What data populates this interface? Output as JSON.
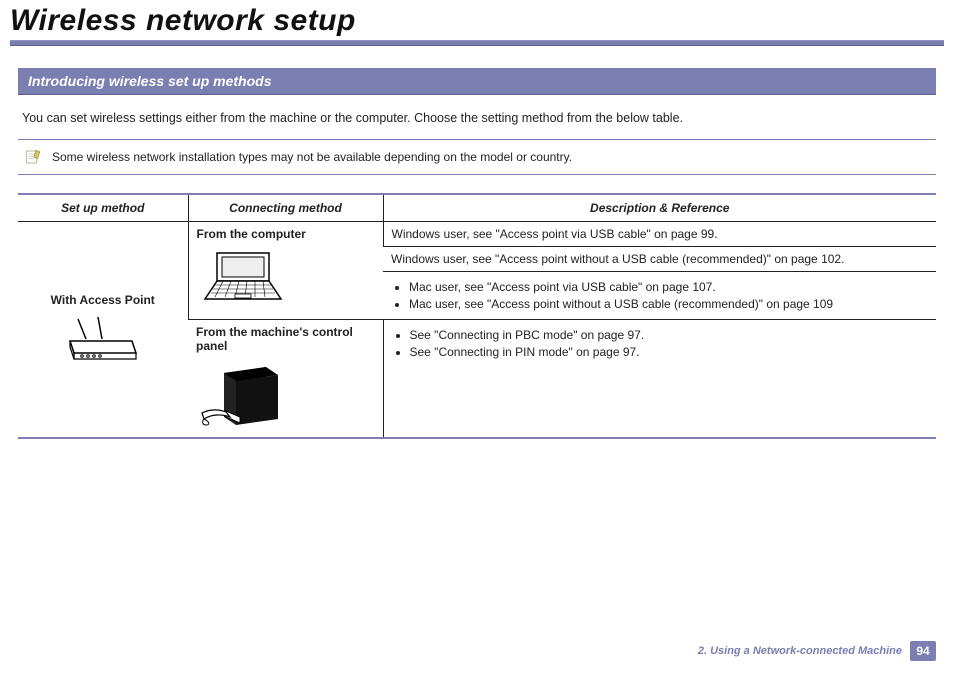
{
  "page": {
    "title": "Wireless network setup"
  },
  "section": {
    "header": "Introducing wireless set up methods",
    "intro": "You can set wireless settings either from the machine or the computer. Choose the setting method from the below table.",
    "note": "Some wireless network installation types may not be available depending on the model or country."
  },
  "table": {
    "headers": {
      "setup": "Set up method",
      "connecting": "Connecting method",
      "description": "Description & Reference"
    },
    "setup_label": "With Access Point",
    "connecting": {
      "from_computer": "From the computer",
      "from_panel": "From the machine's control panel"
    },
    "rows": {
      "win_usb": "Windows user, see \"Access point via USB cable\" on page 99.",
      "win_no_usb": "Windows user, see \"Access point without a USB cable (recommended)\" on page 102.",
      "mac_usb": "Mac user, see \"Access point via USB cable\" on page 107.",
      "mac_no_usb": "Mac user, see \"Access point without a USB cable (recommended)\" on page 109",
      "pbc": "See \"Connecting in PBC mode\" on page 97.",
      "pin": "See \"Connecting in PIN mode\" on page 97."
    }
  },
  "footer": {
    "chapter": "2.  Using a Network-connected Machine",
    "page": "94"
  }
}
